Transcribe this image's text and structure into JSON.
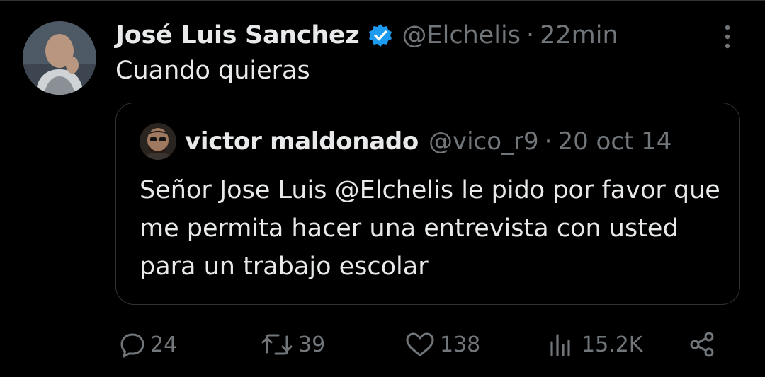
{
  "tweet": {
    "author_name": "José Luis Sanchez",
    "author_handle": "@Elchelis",
    "separator": "·",
    "time": "22min",
    "text": "Cuando quieras"
  },
  "quoted_tweet": {
    "author_name": "victor maldonado",
    "author_handle": "@vico_r9",
    "separator": "·",
    "time": "20 oct 14",
    "text": "Señor Jose Luis  @Elchelis le pido por favor que me permita hacer una entrevista con usted para un trabajo escolar"
  },
  "actions": {
    "replies": "24",
    "reposts": "39",
    "likes": "138",
    "views": "15.2K"
  },
  "colors": {
    "background": "#000000",
    "text": "#e7e9ea",
    "secondary": "#71767b",
    "border": "#2f3336",
    "verified": "#1d9bf0"
  },
  "icons": [
    "verified-badge-icon",
    "more-icon",
    "reply-icon",
    "repost-icon",
    "like-icon",
    "views-icon",
    "share-icon"
  ]
}
